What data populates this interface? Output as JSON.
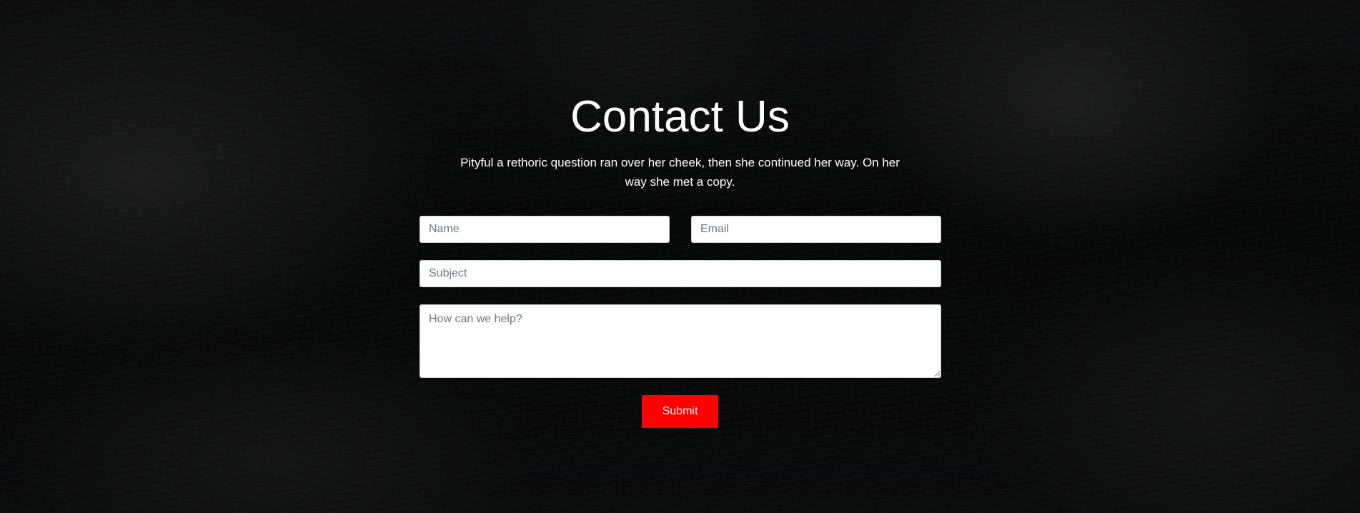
{
  "contact": {
    "title": "Contact Us",
    "description": "Pityful a rethoric question ran over her cheek, then she continued her way. On her way she met a copy."
  },
  "form": {
    "name_placeholder": "Name",
    "email_placeholder": "Email",
    "subject_placeholder": "Subject",
    "message_placeholder": "How can we help?",
    "submit_label": "Submit"
  },
  "colors": {
    "accent": "#ff0000",
    "text": "#ffffff",
    "background": "#0b0c0d"
  }
}
